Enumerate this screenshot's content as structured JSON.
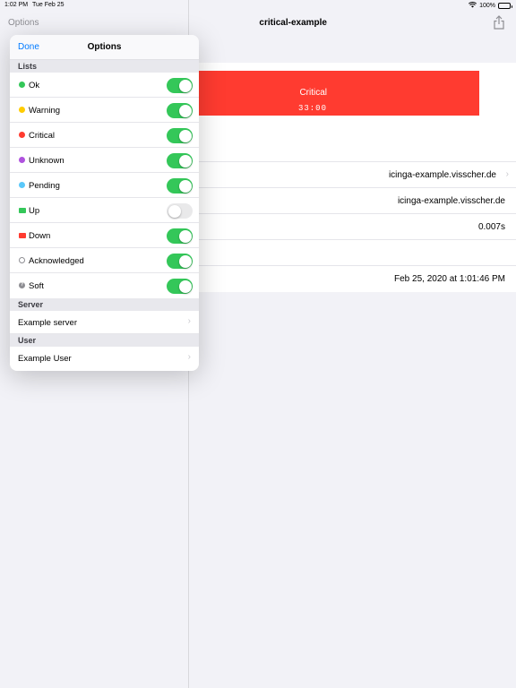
{
  "status_bar": {
    "time": "1:02 PM",
    "date": "Tue Feb 25",
    "battery": "100%"
  },
  "master": {
    "nav_button": "Options"
  },
  "detail": {
    "title": "critical-example",
    "banner": {
      "label": "Critical",
      "time": "33:00",
      "color": "#ff3b30"
    },
    "rows": [
      {
        "value": "icinga-example.visscher.de",
        "chevron": true
      },
      {
        "value": "icinga-example.visscher.de",
        "chevron": false
      },
      {
        "value": "0.007s",
        "chevron": false
      },
      {
        "value": "",
        "chevron": false
      },
      {
        "value": "Feb 25, 2020 at 1:01:46 PM",
        "chevron": false
      }
    ]
  },
  "popover": {
    "done_label": "Done",
    "title": "Options",
    "lists_header": "Lists",
    "lists": [
      {
        "label": "Ok",
        "color": "#34c759",
        "icon": "dot",
        "on": true
      },
      {
        "label": "Warning",
        "color": "#ffcc00",
        "icon": "dot",
        "on": true
      },
      {
        "label": "Critical",
        "color": "#ff3b30",
        "icon": "dot",
        "on": true
      },
      {
        "label": "Unknown",
        "color": "#af52de",
        "icon": "dot",
        "on": true
      },
      {
        "label": "Pending",
        "color": "#5ac8fa",
        "icon": "dot",
        "on": true
      },
      {
        "label": "Up",
        "color": "#34c759",
        "icon": "square",
        "on": false
      },
      {
        "label": "Down",
        "color": "#ff3b30",
        "icon": "square",
        "on": true
      },
      {
        "label": "Acknowledged",
        "color": "#8e8e93",
        "icon": "ring",
        "on": true
      },
      {
        "label": "Soft",
        "color": "#8e8e93",
        "icon": "question",
        "on": true
      }
    ],
    "server_header": "Server",
    "server_item": "Example server",
    "user_header": "User",
    "user_item": "Example User"
  }
}
